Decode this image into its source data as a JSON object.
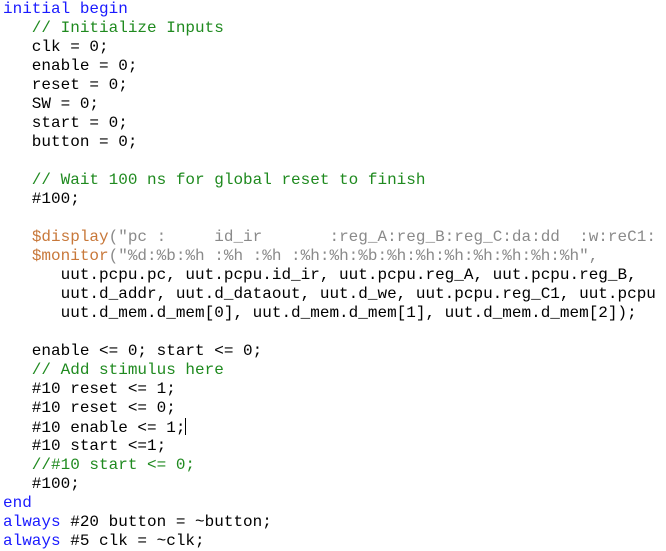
{
  "editor": {
    "language": "verilog",
    "lines": [
      [
        {
          "t": "kw",
          "v": "initial begin"
        }
      ],
      [
        {
          "t": "cm",
          "v": "   // Initialize Inputs"
        }
      ],
      [
        {
          "t": "tx",
          "v": "   clk = 0;"
        }
      ],
      [
        {
          "t": "tx",
          "v": "   enable = 0;"
        }
      ],
      [
        {
          "t": "tx",
          "v": "   reset = 0;"
        }
      ],
      [
        {
          "t": "tx",
          "v": "   SW = 0;"
        }
      ],
      [
        {
          "t": "tx",
          "v": "   start = 0;"
        }
      ],
      [
        {
          "t": "tx",
          "v": "   button = 0;"
        }
      ],
      [],
      [
        {
          "t": "cm",
          "v": "   // Wait 100 ns for global reset to finish"
        }
      ],
      [
        {
          "t": "tx",
          "v": "   #100;"
        }
      ],
      [],
      [
        {
          "t": "tx",
          "v": "   "
        },
        {
          "t": "sys",
          "v": "$display"
        },
        {
          "t": "str",
          "v": "(\"pc :     id_ir       :reg_A:reg_B:reg_C:da:dd  :w:reC1:"
        }
      ],
      [
        {
          "t": "tx",
          "v": "   "
        },
        {
          "t": "sys",
          "v": "$monitor"
        },
        {
          "t": "str",
          "v": "(\"%d:%b:%h :%h :%h :%h:%h:%b:%h:%h:%h:%h:%h:%h:%h\","
        }
      ],
      [
        {
          "t": "tx",
          "v": "      uut.pcpu.pc, uut.pcpu.id_ir, uut.pcpu.reg_A, uut.pcpu.reg_B,"
        }
      ],
      [
        {
          "t": "tx",
          "v": "      uut.d_addr, uut.d_dataout, uut.d_we, uut.pcpu.reg_C1, uut.pcpu"
        }
      ],
      [
        {
          "t": "tx",
          "v": "      uut.d_mem.d_mem[0], uut.d_mem.d_mem[1], uut.d_mem.d_mem[2]);"
        }
      ],
      [],
      [
        {
          "t": "tx",
          "v": "   enable <= 0; start <= 0;"
        }
      ],
      [
        {
          "t": "cm",
          "v": "   // Add stimulus here"
        }
      ],
      [
        {
          "t": "tx",
          "v": "   #10 reset <= 1;"
        }
      ],
      [
        {
          "t": "tx",
          "v": "   #10 reset <= 0;"
        }
      ],
      [
        {
          "t": "tx",
          "v": "   #10 enable <= 1;"
        },
        {
          "t": "cursor",
          "v": ""
        }
      ],
      [
        {
          "t": "tx",
          "v": "   #10 start <=1;"
        }
      ],
      [
        {
          "t": "cm",
          "v": "   //#10 start <= 0;"
        }
      ],
      [
        {
          "t": "tx",
          "v": "   #100;"
        }
      ],
      [
        {
          "t": "kw",
          "v": "end"
        }
      ],
      [
        {
          "t": "kw",
          "v": "always"
        },
        {
          "t": "tx",
          "v": " #20 button = ~button;"
        }
      ],
      [
        {
          "t": "kw",
          "v": "always"
        },
        {
          "t": "tx",
          "v": " #5 clk = ~clk;"
        }
      ]
    ]
  }
}
